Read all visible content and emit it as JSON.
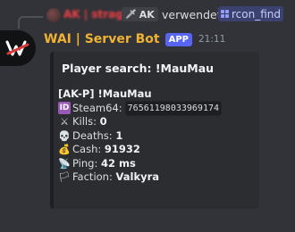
{
  "reply": {
    "username": "AK | strag",
    "tag": "AK",
    "tag_icon": "sword-icon",
    "action_text": "verwendet",
    "command": "rcon_find"
  },
  "message": {
    "bot_name": "WAI | Server Bot",
    "badge": "APP",
    "timestamp": "21:11",
    "avatar_icon": "wai-logo-icon"
  },
  "embed": {
    "title": "Player search: !MauMau",
    "player_line": "[AK-P] !MauMau",
    "steam_label": "Steam64:",
    "steam_id": "76561198033969174",
    "kills_label": "Kills:",
    "kills": "0",
    "deaths_label": "Deaths:",
    "deaths": "1",
    "cash_label": "Cash:",
    "cash": "91932",
    "ping_label": "Ping:",
    "ping": "42 ms",
    "faction_label": "Faction:",
    "faction": "Valkyra",
    "icons": [
      "id-icon",
      "swords-icon",
      "skull-icon",
      "money-bag-icon",
      "satellite-icon",
      "flag-icon"
    ]
  },
  "colors": {
    "background": "#313338",
    "bot_name": "#f0b232",
    "reply_user": "#f23f43",
    "badge": "#5865f2"
  }
}
